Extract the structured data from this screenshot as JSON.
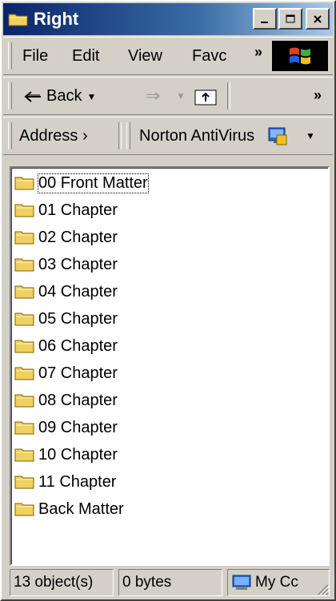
{
  "window": {
    "title": "Right"
  },
  "menu": {
    "items": [
      "File",
      "Edit",
      "View",
      "Favc"
    ],
    "more": "»"
  },
  "toolbar": {
    "back_label": "Back",
    "more": "»"
  },
  "links": {
    "address_label": "Address",
    "address_more": "›",
    "norton_label": "Norton AntiVirus"
  },
  "files": [
    "00 Front Matter",
    "01 Chapter",
    "02 Chapter",
    "03 Chapter",
    "04 Chapter",
    "05 Chapter",
    "06 Chapter",
    "07 Chapter",
    "08 Chapter",
    "09 Chapter",
    "10 Chapter",
    "11 Chapter",
    "Back Matter"
  ],
  "status": {
    "objects": "13 object(s)",
    "size": "0 bytes",
    "zone": "My Cc"
  },
  "colors": {
    "titlebar": "#0a246a",
    "folder": "#f0d060",
    "face": "#d4d0c8"
  }
}
